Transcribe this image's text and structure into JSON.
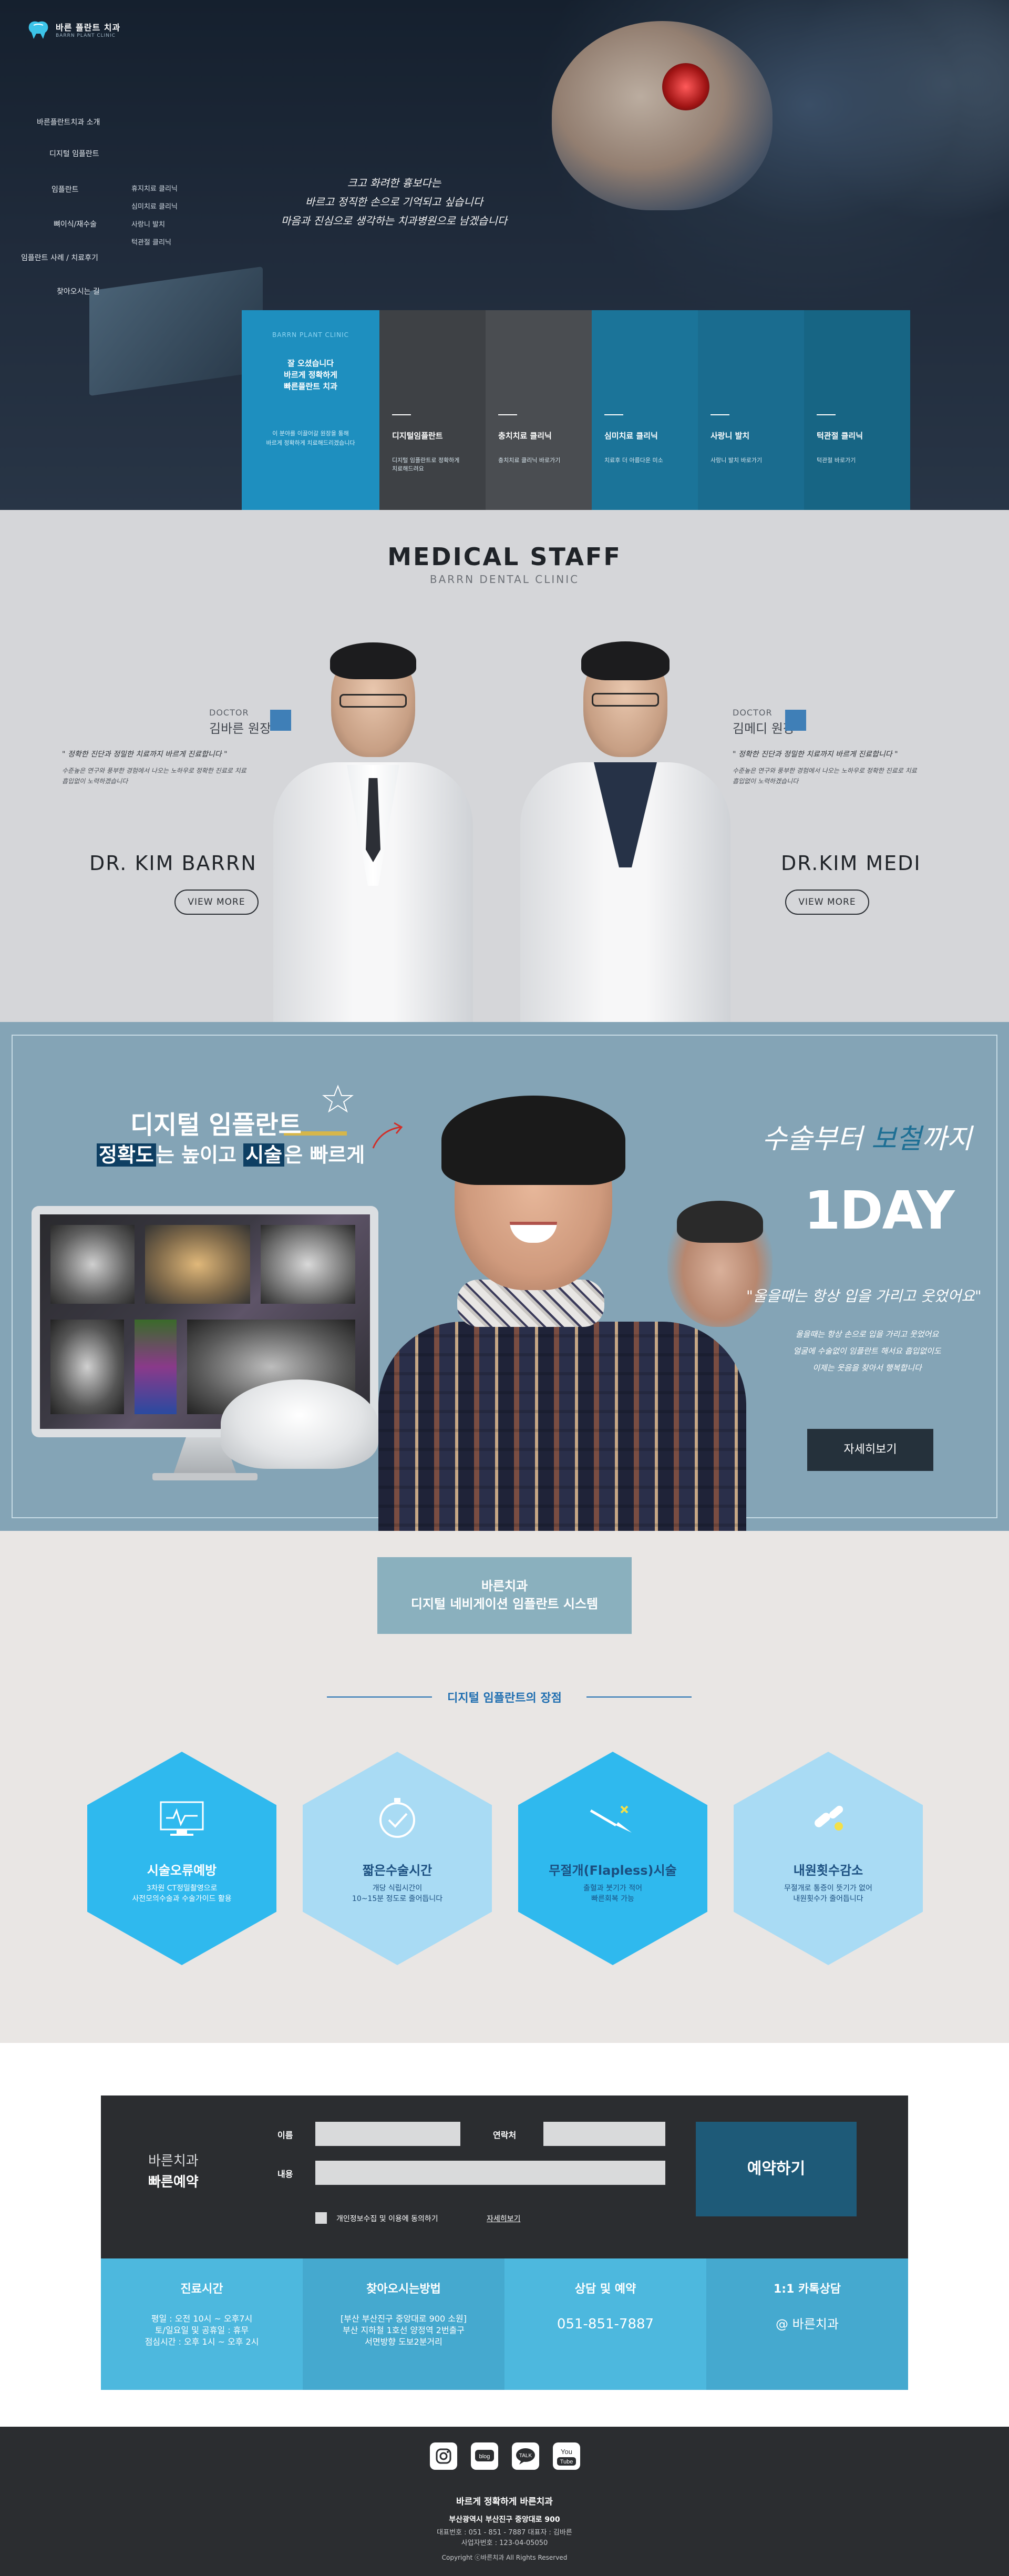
{
  "header": {
    "logo_text": "바른 플란트 치과",
    "logo_sub": "BARRN PLANT CLINIC"
  },
  "nav": {
    "items": [
      "바른플란트치과 소개",
      "디지털 임플란트",
      "임플란트",
      "뼈이식/재수술",
      "임플란트 사례 / 치료후기",
      "찾아오시는 길"
    ],
    "sub": [
      "휴지치료 클리닉",
      "심미치료 클리닉",
      "사랑니 발치",
      "턱관절 클리닉"
    ]
  },
  "hero": {
    "slogan": [
      "크고 화려한 흉보다는",
      "바르고 정직한 손으로 기억되고 싶습니다",
      "마음과 진심으로 생각하는 치과병원으로 남겠습니다"
    ]
  },
  "panels": {
    "intro_brand": "BARRN PLANT CLINIC",
    "intro_lines": [
      "잘 오셨습니다",
      "바르게 정확하게",
      "빠른플란트 치과"
    ],
    "intro_small": [
      "이 분야를 이끌어갈 원장을 통해",
      "바르게 정확하게 치료해드리겠습니다"
    ],
    "items": [
      {
        "title": "디지털임플란트",
        "desc": "디지털 임플란트로 정확하게\n치료해드려요"
      },
      {
        "title": "충치치료 클리닉",
        "desc": "충치치료 클리닉 바로가기"
      },
      {
        "title": "심미치료 클리닉",
        "desc": "치료후 더 아름다운 미소"
      },
      {
        "title": "사랑니 발치",
        "desc": "사랑니 발치 바로가기"
      },
      {
        "title": "턱관절 클리닉",
        "desc": "턱관절 바로가기"
      }
    ]
  },
  "staff": {
    "title": "MEDICAL STAFF",
    "subtitle": "BARRN DENTAL CLINIC",
    "doctors": [
      {
        "label": "DOCTOR",
        "name": "김바른 원장",
        "quote": "\" 정확한 진단과 정밀한 치료까지 바르게 진료합니다 \"",
        "desc": [
          "수준높은 연구와 풍부한 경험에서 나오는 노하우로 정확한 진료로 치료",
          "흡입없이 노력하겠습니다"
        ],
        "big": "DR. KIM BARRN",
        "btn": "VIEW MORE"
      },
      {
        "label": "DOCTOR",
        "name": "김메디 원장",
        "quote": "\" 정확한 진단과 정밀한 치료까지 바르게 진료합니다 \"",
        "desc": [
          "수준높은 연구와 풍부한 경험에서 나오는 노하우로 정확한 진료로 치료",
          "흡입없이 노력하겠습니다"
        ],
        "big": "DR.KIM MEDI",
        "btn": "VIEW MORE"
      }
    ]
  },
  "implant": {
    "title": "디지털 임플란트",
    "line2_a": "정확도",
    "line2_b": "는 높이고 ",
    "line2_c": "시술",
    "line2_d": "은 빠르게",
    "right_a": "수술부터 ",
    "right_b": "보철",
    "right_c": "까지",
    "oneday": "1DAY",
    "quote": "\"울을때는 항상 입을 가리고 웃었어요\"",
    "desc": [
      "울을때는 항상 손으로 입을 가리고 웃었어요",
      "얼굴에 수술없이 임플란트 해서요 흡입없이도",
      "이제는 웃음을 찾아서 행복합니다"
    ],
    "button": "자세히보기"
  },
  "advantages": {
    "box_line1": "바른치과",
    "box_line2": "디지털 네비게이션 임플란트 시스템",
    "subtitle": "디지털 임플란트의 장점",
    "items": [
      {
        "title": "시술오류예방",
        "desc": "3차원 CT정밀촬영으로\n사전모의수술과 수술가이드 활용",
        "icon": "monitor-icon",
        "bg": "#2fb9ee",
        "fg": "#ffffff"
      },
      {
        "title": "짧은수술시간",
        "desc": "개당 식립시간이\n10~15분 정도로 줄어듭니다",
        "icon": "clock-check-icon",
        "bg": "#a9dbf4",
        "fg": "#1b4f80"
      },
      {
        "title": "무절개(Flapless)시술",
        "desc": "출혈과 붓기가 적어\n빠른회복 가능",
        "icon": "scalpel-icon",
        "bg": "#2fb9ee",
        "fg": "#ffffff"
      },
      {
        "title": "내원횟수감소",
        "desc": "무절개로 통증이 뜻기가 없어\n내원횟수가 줄어듭니다",
        "icon": "pills-icon",
        "bg": "#a9dbf4",
        "fg": "#1b4f80"
      }
    ]
  },
  "reservation": {
    "title1": "바른치과",
    "title2": "빠른예약",
    "name_label": "이름",
    "phone_label": "연락처",
    "content_label": "내용",
    "agree": "개인정보수집 및 이용에 동의하기",
    "more": "자세히보기",
    "button": "예약하기",
    "info": [
      {
        "title": "진료시간",
        "body": "평일 : 오전 10시 ~ 오후7시\n토/일요일 및 공휴일 : 휴무\n점심시간 : 오후 1시 ~ 오후 2시",
        "bg": "#4db8de"
      },
      {
        "title": "찾아오시는방법",
        "body": "[부산 부산진구 중앙대로 900 소원]\n부산 지하철 1호선 양정역 2번출구\n서면방향 도보2분거리",
        "bg": "#45a9cf"
      },
      {
        "title": "상담 및 예약",
        "body": "051-851-7887",
        "bg": "#4db8de"
      },
      {
        "title": "1:1 카톡상담",
        "body": "@ 바른치과",
        "bg": "#45a9cf"
      }
    ]
  },
  "footer": {
    "sns": [
      "instagram-icon",
      "blog-icon",
      "talk-icon",
      "youtube-icon"
    ],
    "sns_labels": [
      "",
      "blog",
      "TALK",
      "You Tube"
    ],
    "title": "바르게 정확하게 바른치과",
    "address": "부산광역시 부산진구 중앙대로 900",
    "contact": "대표번호 : 051 - 851 - 7887  대표자 : 김바른",
    "biz": "사업자번호 : 123-04-05050",
    "copyright": "Copyright ⓒ바른치과 All Rights Reserved"
  },
  "colors": {
    "accent": "#2fb9ee",
    "dark": "#2b2d30",
    "staff_bg": "#d5d6d9",
    "implant_bg": "#84a4b6"
  }
}
